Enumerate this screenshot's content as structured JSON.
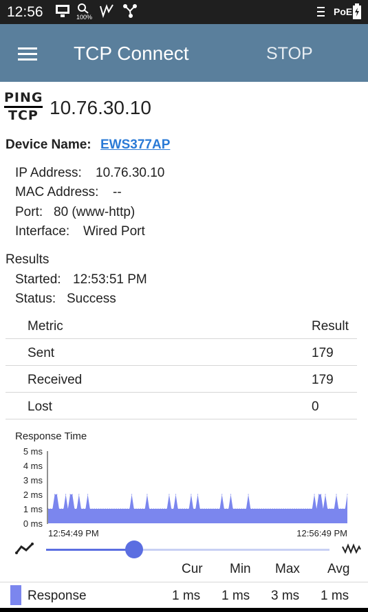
{
  "status_bar": {
    "time": "12:56",
    "battery_pct": "100%",
    "poe": "PoE"
  },
  "app_bar": {
    "title": "TCP Connect",
    "stop_label": "STOP"
  },
  "logo": {
    "line1": "PING",
    "line2": "TCP"
  },
  "target": "10.76.30.10",
  "device": {
    "name_label": "Device Name:",
    "name_value": "EWS377AP",
    "ip_label": "IP Address:",
    "ip_value": "10.76.30.10",
    "mac_label": "MAC Address:",
    "mac_value": "--",
    "port_label": "Port:",
    "port_value": "80 (www-http)",
    "iface_label": "Interface:",
    "iface_value": "Wired Port"
  },
  "results": {
    "heading": "Results",
    "started_label": "Started:",
    "started_value": "12:53:51 PM",
    "status_label": "Status:",
    "status_value": "Success"
  },
  "metrics_table": {
    "headers": {
      "metric": "Metric",
      "result": "Result"
    },
    "rows": [
      {
        "metric": "Sent",
        "result": "179"
      },
      {
        "metric": "Received",
        "result": "179"
      },
      {
        "metric": "Lost",
        "result": "0"
      }
    ]
  },
  "chart_data": {
    "type": "area",
    "title": "Response Time",
    "ylabel": "",
    "xlabel": "",
    "ylim": [
      0,
      5
    ],
    "y_ticks": [
      "5 ms",
      "4 ms",
      "3 ms",
      "2 ms",
      "1 ms",
      "0 ms"
    ],
    "x_start_label": "12:54:49 PM",
    "x_end_label": "12:56:49 PM",
    "series": [
      {
        "name": "Response",
        "color": "#7b86ee",
        "values": [
          1,
          1,
          1,
          2,
          2,
          1,
          1,
          1,
          2,
          1,
          2,
          2,
          1,
          1,
          2,
          1,
          1,
          1,
          2,
          1,
          1,
          1,
          1,
          1,
          1,
          1,
          1,
          1,
          1,
          1,
          1,
          1,
          1,
          1,
          1,
          1,
          1,
          1,
          2,
          1,
          1,
          1,
          1,
          1,
          1,
          2,
          1,
          1,
          1,
          1,
          1,
          1,
          1,
          1,
          1,
          2,
          1,
          1,
          2,
          1,
          1,
          1,
          1,
          1,
          1,
          2,
          1,
          1,
          2,
          1,
          1,
          1,
          1,
          1,
          1,
          1,
          1,
          1,
          1,
          2,
          1,
          1,
          1,
          2,
          1,
          1,
          1,
          1,
          1,
          1,
          1,
          2,
          1,
          1,
          1,
          1,
          1,
          1,
          1,
          1,
          1,
          1,
          1,
          1,
          1,
          1,
          1,
          1,
          1,
          1,
          1,
          1,
          1,
          1,
          1,
          1,
          1,
          1,
          1,
          1,
          1,
          2,
          1,
          2,
          2,
          1,
          2,
          1,
          1,
          1,
          1,
          2,
          1,
          1,
          1,
          1,
          2
        ]
      }
    ]
  },
  "slider": {
    "position": 0.31
  },
  "stats": {
    "headers": {
      "cur": "Cur",
      "min": "Min",
      "max": "Max",
      "avg": "Avg"
    },
    "series_label": "Response",
    "cur": "1 ms",
    "min": "1 ms",
    "max": "3 ms",
    "avg": "1 ms"
  }
}
